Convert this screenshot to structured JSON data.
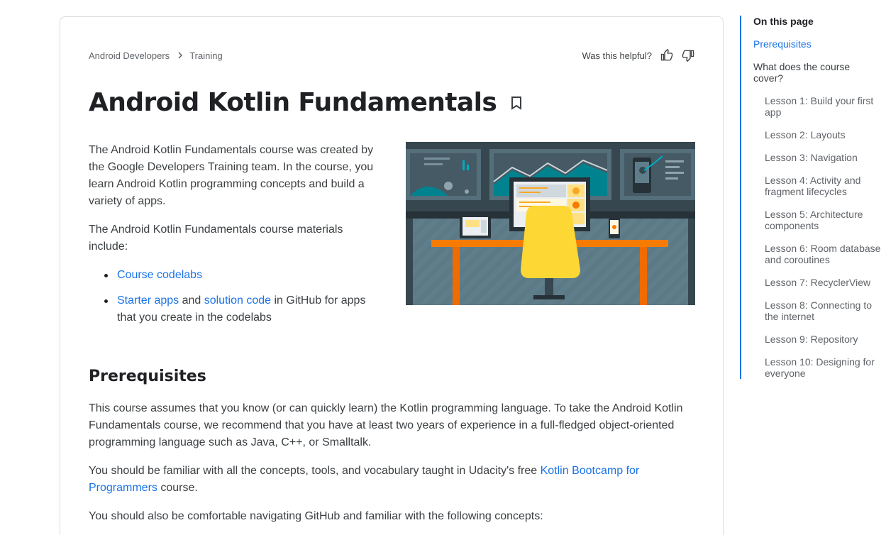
{
  "breadcrumb": {
    "items": [
      "Android Developers",
      "Training"
    ]
  },
  "helpful": {
    "label": "Was this helpful?"
  },
  "page_title": "Android Kotlin Fundamentals",
  "intro": {
    "p1": "The Android Kotlin Fundamentals course was created by the Google Developers Training team. In the course, you learn Android Kotlin programming concepts and build a variety of apps.",
    "p2": "The Android Kotlin Fundamentals course materials include:",
    "list": {
      "item1_link": "Course codelabs",
      "item2_link1": "Starter apps",
      "item2_and": " and ",
      "item2_link2": "solution code",
      "item2_rest": " in GitHub for apps that you create in the codelabs"
    }
  },
  "prereq": {
    "heading": "Prerequisites",
    "p1": "This course assumes that you know (or can quickly learn) the Kotlin programming language. To take the Android Kotlin Fundamentals course, we recommend that you have at least two years of experience in a full-fledged object-oriented programming language such as Java, C++, or Smalltalk.",
    "p2_pre": "You should be familiar with all the concepts, tools, and vocabulary taught in Udacity's free ",
    "p2_link": "Kotlin Bootcamp for Programmers",
    "p2_post": " course.",
    "p3": "You should also be comfortable navigating GitHub and familiar with the following concepts:"
  },
  "toc": {
    "title": "On this page",
    "items": [
      {
        "label": "Prerequisites",
        "active": true,
        "sub": false
      },
      {
        "label": "What does the course cover?",
        "active": false,
        "sub": false
      },
      {
        "label": "Lesson 1: Build your first app",
        "active": false,
        "sub": true
      },
      {
        "label": "Lesson 2: Layouts",
        "active": false,
        "sub": true
      },
      {
        "label": "Lesson 3: Navigation",
        "active": false,
        "sub": true
      },
      {
        "label": "Lesson 4: Activity and fragment lifecycles",
        "active": false,
        "sub": true
      },
      {
        "label": "Lesson 5: Architecture components",
        "active": false,
        "sub": true
      },
      {
        "label": "Lesson 6: Room database and coroutines",
        "active": false,
        "sub": true
      },
      {
        "label": "Lesson 7: RecyclerView",
        "active": false,
        "sub": true
      },
      {
        "label": "Lesson 8: Connecting to the internet",
        "active": false,
        "sub": true
      },
      {
        "label": "Lesson 9: Repository",
        "active": false,
        "sub": true
      },
      {
        "label": "Lesson 10: Designing for everyone",
        "active": false,
        "sub": true
      }
    ]
  },
  "colors": {
    "link": "#1a73e8",
    "accent_orange": "#f57c00",
    "accent_yellow": "#fdd663",
    "hero_bg": "#37474f"
  },
  "icons": [
    "chevron-right-icon",
    "thumb-up-icon",
    "thumb-down-icon",
    "bookmark-icon"
  ]
}
